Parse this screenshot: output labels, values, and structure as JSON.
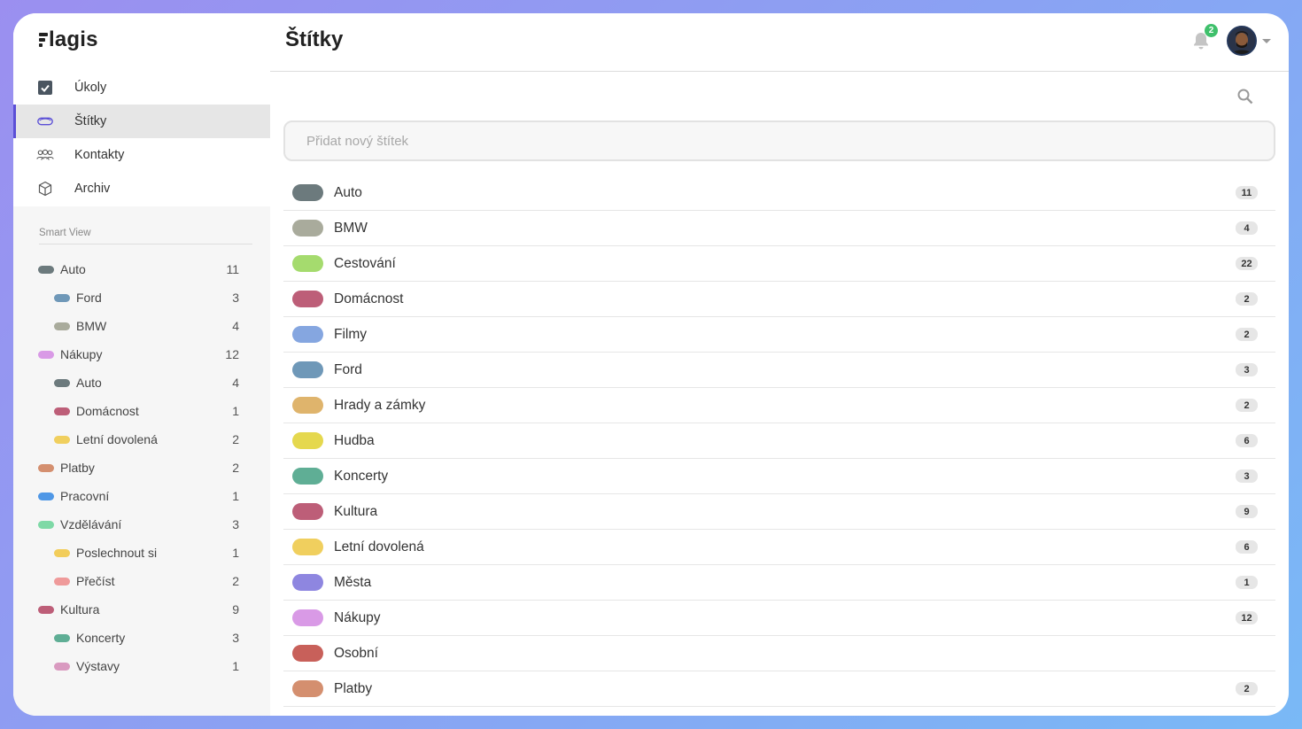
{
  "app": {
    "logo_text": "lagis"
  },
  "nav": [
    {
      "label": "Úkoly",
      "icon": "checkbox-icon",
      "active": false
    },
    {
      "label": "Štítky",
      "icon": "tag-icon",
      "active": true
    },
    {
      "label": "Kontakty",
      "icon": "contacts-icon",
      "active": false
    },
    {
      "label": "Archiv",
      "icon": "archive-icon",
      "active": false
    }
  ],
  "smart_view": {
    "title": "Smart View",
    "items": [
      {
        "label": "Auto",
        "count": "11",
        "color": "#6c7a7d",
        "level": 0
      },
      {
        "label": "Ford",
        "count": "3",
        "color": "#6f98b8",
        "level": 1
      },
      {
        "label": "BMW",
        "count": "4",
        "color": "#a9ab9c",
        "level": 1
      },
      {
        "label": "Nákupy",
        "count": "12",
        "color": "#d99ae6",
        "level": 0
      },
      {
        "label": "Auto",
        "count": "4",
        "color": "#6c7a7d",
        "level": 1
      },
      {
        "label": "Domácnost",
        "count": "1",
        "color": "#bd5e78",
        "level": 1
      },
      {
        "label": "Letní dovolená",
        "count": "2",
        "color": "#f0cf5e",
        "level": 1
      },
      {
        "label": "Platby",
        "count": "2",
        "color": "#d48f6f",
        "level": 0
      },
      {
        "label": "Pracovní",
        "count": "1",
        "color": "#4f97e6",
        "level": 0
      },
      {
        "label": "Vzdělávání",
        "count": "3",
        "color": "#7ed9a6",
        "level": 0
      },
      {
        "label": "Poslechnout si",
        "count": "1",
        "color": "#f2cd5a",
        "level": 1
      },
      {
        "label": "Přečíst",
        "count": "2",
        "color": "#ef9a9a",
        "level": 1
      },
      {
        "label": "Kultura",
        "count": "9",
        "color": "#bd5e78",
        "level": 0
      },
      {
        "label": "Koncerty",
        "count": "3",
        "color": "#5fae95",
        "level": 1
      },
      {
        "label": "Výstavy",
        "count": "1",
        "color": "#d99ac0",
        "level": 1
      }
    ]
  },
  "header": {
    "title": "Štítky",
    "notifications": "2"
  },
  "add_tag": {
    "placeholder": "Přidat nový štítek"
  },
  "tags": [
    {
      "name": "Auto",
      "count": "11",
      "color": "#6c7a7d"
    },
    {
      "name": "BMW",
      "count": "4",
      "color": "#a9ab9c"
    },
    {
      "name": "Cestování",
      "count": "22",
      "color": "#a5db6e"
    },
    {
      "name": "Domácnost",
      "count": "2",
      "color": "#bd5e78"
    },
    {
      "name": "Filmy",
      "count": "2",
      "color": "#85a6e0"
    },
    {
      "name": "Ford",
      "count": "3",
      "color": "#6f98b8"
    },
    {
      "name": "Hrady a zámky",
      "count": "2",
      "color": "#dfb46c"
    },
    {
      "name": "Hudba",
      "count": "6",
      "color": "#e5d84e"
    },
    {
      "name": "Koncerty",
      "count": "3",
      "color": "#5fae95"
    },
    {
      "name": "Kultura",
      "count": "9",
      "color": "#bd5e78"
    },
    {
      "name": "Letní dovolená",
      "count": "6",
      "color": "#f0cf5e"
    },
    {
      "name": "Města",
      "count": "1",
      "color": "#8e86e0"
    },
    {
      "name": "Nákupy",
      "count": "12",
      "color": "#d99ae6"
    },
    {
      "name": "Osobní",
      "count": "",
      "color": "#c8605a"
    },
    {
      "name": "Platby",
      "count": "2",
      "color": "#d48f6f"
    }
  ]
}
